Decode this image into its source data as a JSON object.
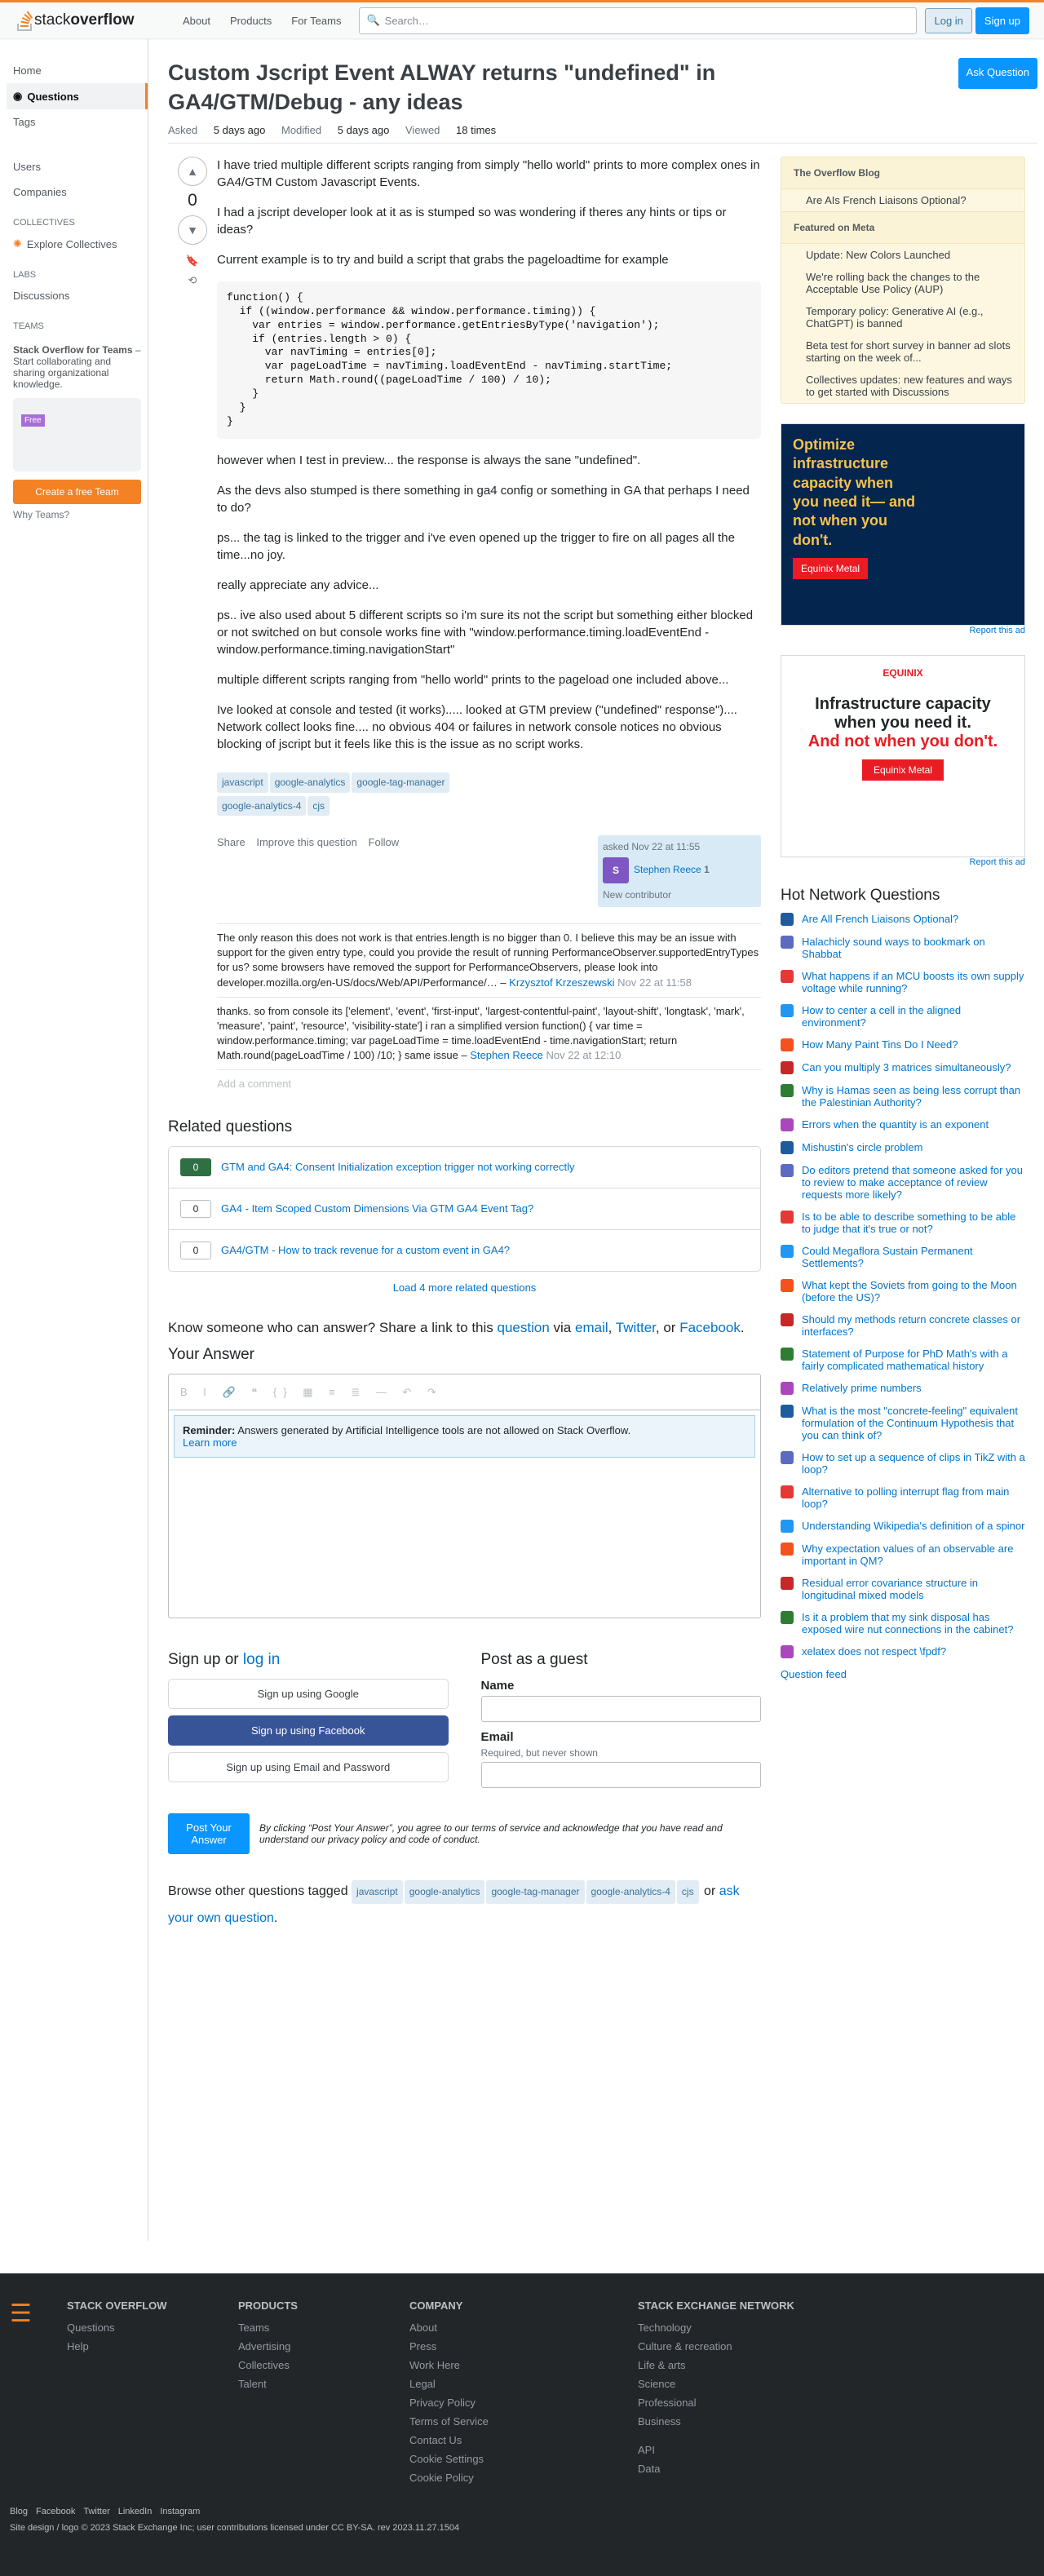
{
  "topbar": {
    "logo": "stackoverflow",
    "logo_bold": "overflow",
    "logo_plain": "stack",
    "about": "About",
    "products": "Products",
    "for_teams": "For Teams",
    "search_placeholder": "Search…",
    "login": "Log in",
    "signup": "Sign up"
  },
  "nav": {
    "home": "Home",
    "questions": "Questions",
    "tags": "Tags",
    "users": "Users",
    "companies": "Companies",
    "collectives": "COLLECTIVES",
    "explore": "Explore Collectives",
    "labs": "LABS",
    "discussions": "Discussions",
    "teams": "TEAMS",
    "teams_title": "Stack Overflow for Teams",
    "teams_suffix": " – Start collaborating and sharing organizational knowledge.",
    "teams_cta": "Create a free Team",
    "why_teams": "Why Teams?"
  },
  "question": {
    "title": "Custom Jscript Event ALWAY returns \"undefined\" in GA4/GTM/Debug - any ideas",
    "ask": "Ask Question",
    "asked_label": "Asked",
    "asked": "5 days ago",
    "modified_label": "Modified",
    "modified": "5 days ago",
    "viewed_label": "Viewed",
    "viewed": "18 times",
    "score": "0",
    "p1": "I have tried multiple different scripts ranging from simply \"hello world\" prints to more complex ones in GA4/GTM Custom Javascript Events.",
    "p2": "I had a jscript developer look at it as is stumped so was wondering if theres any hints or tips or ideas?",
    "p3": "Current example is to try and build a script that grabs the pageloadtime for example",
    "code": "function() {\n  if ((window.performance && window.performance.timing)) {\n    var entries = window.performance.getEntriesByType('navigation');\n    if (entries.length > 0) {\n      var navTiming = entries[0];\n      var pageLoadTime = navTiming.loadEventEnd - navTiming.startTime;\n      return Math.round((pageLoadTime / 100) / 10);\n    }\n  }\n}",
    "p4": "however when I test in preview... the response is always the sane \"undefined\".",
    "p5": "As the devs also stumped is there something in ga4 config or something in GA that perhaps I need to do?",
    "p6": "ps... the tag is linked to the trigger and i've even opened up the trigger to fire on all pages all the time...no joy.",
    "p7": "really appreciate any advice...",
    "p8": "ps.. ive also used about 5 different scripts so i'm sure its not the script but something either blocked or not switched on but console works fine with \"window.performance.timing.loadEventEnd - window.performance.timing.navigationStart\"",
    "p9": "multiple different scripts ranging from \"hello world\" prints to the pageload one included above...",
    "p10": "Ive looked at console and tested (it works)..... looked at GTM preview (\"undefined\" response\")....",
    "p11": "Network collect looks fine.... no obvious 404 or failures in network console notices no obvious blocking of jscript but it feels like this is the issue as no script works.",
    "tags": [
      "javascript",
      "google-analytics",
      "google-tag-manager",
      "google-analytics-4",
      "cjs"
    ],
    "share": "Share",
    "improve": "Improve this question",
    "follow": "Follow",
    "asked_card": "asked Nov 22 at 11:55",
    "user": "Stephen Reece",
    "user_rep": "1",
    "user_initial": "S",
    "new_contributor": "New contributor"
  },
  "comments": [
    {
      "text": "The only reason this does not work is that entries.length is no bigger than 0. I believe this may be an issue with support for the given entry type, could you provide the result of running PerformanceObserver.supportedEntryTypes for us? some browsers have removed the support for PerformanceObservers, please look into developer.mozilla.org/en-US/docs/Web/API/Performance/…",
      "user": "Krzysztof Krzeszewski",
      "date": "Nov 22 at 11:58"
    },
    {
      "text": "thanks. so from console its ['element', 'event', 'first-input', 'largest-contentful-paint', 'layout-shift', 'longtask', 'mark', 'measure', 'paint', 'resource', 'visibility-state'] i ran a simplified version function() { var time = window.performance.timing; var pageLoadTime = time.loadEventEnd - time.navigationStart; return Math.round(pageLoadTime / 100) /10; } same issue",
      "user": "Stephen Reece",
      "date": "Nov 22 at 12:10"
    }
  ],
  "add_comment": "Add a comment",
  "related": {
    "title": "Related questions",
    "items": [
      {
        "score": "0",
        "answered": true,
        "title": "GTM and GA4: Consent Initialization exception trigger not working correctly"
      },
      {
        "score": "0",
        "answered": false,
        "title": "GA4 - Item Scoped Custom Dimensions Via GTM GA4 Event Tag?"
      },
      {
        "score": "0",
        "answered": false,
        "title": "GA4/GTM - How to track revenue for a custom event in GA4?"
      }
    ],
    "more": "Load 4 more related questions"
  },
  "share_prompt": {
    "text": "Know someone who can answer? Share a link to this",
    "question": "question",
    "via": "via",
    "email": "email",
    "twitter": "Twitter",
    "or": "or",
    "facebook": "Facebook"
  },
  "answer": {
    "title": "Your Answer",
    "reminder_label": "Reminder:",
    "reminder": "Answers generated by Artificial Intelligence tools are not allowed on Stack Overflow.",
    "learn": "Learn more"
  },
  "signup": {
    "title": "Sign up",
    "or": "or",
    "login": "log in",
    "google": "Sign up using Google",
    "facebook": "Sign up using Facebook",
    "email": "Sign up using Email and Password",
    "guest": "Post as a guest",
    "name": "Name",
    "email_label": "Email",
    "email_help": "Required, but never shown",
    "post": "Post Your Answer",
    "terms": "By clicking “Post Your Answer”, you agree to our terms of service and acknowledge that you have read and understand our privacy policy and code of conduct."
  },
  "browse": {
    "text": "Browse other questions tagged",
    "tags": [
      "javascript",
      "google-analytics",
      "google-tag-manager",
      "google-analytics-4",
      "cjs"
    ],
    "or": "or",
    "ask": "ask your own question"
  },
  "sidebar": {
    "blog_title": "The Overflow Blog",
    "blog": [
      "Are AIs French Liaisons Optional?",
      "We're rolling back the changes to the Acceptable Use Policy (AUP)"
    ],
    "meta_title": "Featured on Meta",
    "meta": [
      "Update: New Colors Launched",
      "We're rolling back the changes to the Acceptable Use Policy (AUP)",
      "Temporary policy: Generative AI (e.g., ChatGPT) is banned",
      "Beta test for short survey in banner ad slots starting on the week of...",
      "Collectives updates: new features and ways to get started with Discussions"
    ],
    "ad1_text": "Optimize infrastructure capacity when you need it— and not when you don't.",
    "ad1_btn": "Equinix Metal",
    "ad2_brand": "EQUINIX",
    "ad2_text": "Infrastructure capacity when you need it.",
    "ad2_red": "And not when you don't.",
    "ad2_btn": "Equinix Metal",
    "report": "Report this ad",
    "hot_title": "Hot Network Questions",
    "hot": [
      "Are All French Liaisons Optional?",
      "Halachicly sound ways to bookmark on Shabbat",
      "What happens if an MCU boosts its own supply voltage while running?",
      "How to center a cell in the aligned environment?",
      "How Many Paint Tins Do I Need?",
      "Can you multiply 3 matrices simultaneously?",
      "Why is Hamas seen as being less corrupt than the Palestinian Authority?",
      "Errors when the quantity is an exponent",
      "Mishustin's circle problem",
      "Do editors pretend that someone asked for you to review to make acceptance of review requests more likely?",
      "Is to be able to describe something to be able to judge that it's true or not?",
      "Could Megaflora Sustain Permanent Settlements?",
      "What kept the Soviets from going to the Moon (before the US)?",
      "Should my methods return concrete classes or interfaces?",
      "Statement of Purpose for PhD Math's with a fairly complicated mathematical history",
      "Relatively prime numbers",
      "What is the most \"concrete-feeling\" equivalent formulation of the Continuum Hypothesis that you can think of?",
      "How to set up a sequence of clips in TikZ with a loop?",
      "Alternative to polling interrupt flag from main loop?",
      "Understanding Wikipedia's definition of a spinor",
      "Why expectation values of an observable are important in QM?",
      "Residual error covariance structure in longitudinal mixed models",
      "Is it a problem that my sink disposal has exposed wire nut connections in the cabinet?",
      "xelatex does not respect \\fpdf?"
    ],
    "feed": "Question feed"
  },
  "footer": {
    "so": "STACK OVERFLOW",
    "so_links": [
      "Questions",
      "Help"
    ],
    "products": "PRODUCTS",
    "products_links": [
      "Teams",
      "Advertising",
      "Collectives",
      "Talent"
    ],
    "company": "COMPANY",
    "company_links": [
      "About",
      "Press",
      "Work Here",
      "Legal",
      "Privacy Policy",
      "Terms of Service",
      "Contact Us",
      "Cookie Settings",
      "Cookie Policy"
    ],
    "network": "STACK EXCHANGE NETWORK",
    "network_links": [
      "Technology",
      "Culture & recreation",
      "Life & arts",
      "Science",
      "Professional",
      "Business"
    ],
    "extra_links": [
      "API",
      "Data"
    ],
    "social": [
      "Blog",
      "Facebook",
      "Twitter",
      "LinkedIn",
      "Instagram"
    ],
    "copyright": "Site design / logo © 2023 Stack Exchange Inc; user contributions licensed under CC BY-SA. rev 2023.11.27.1504"
  },
  "colors": {
    "orange": "#f48225",
    "blue": "#0a95ff",
    "link": "#0074cc"
  }
}
